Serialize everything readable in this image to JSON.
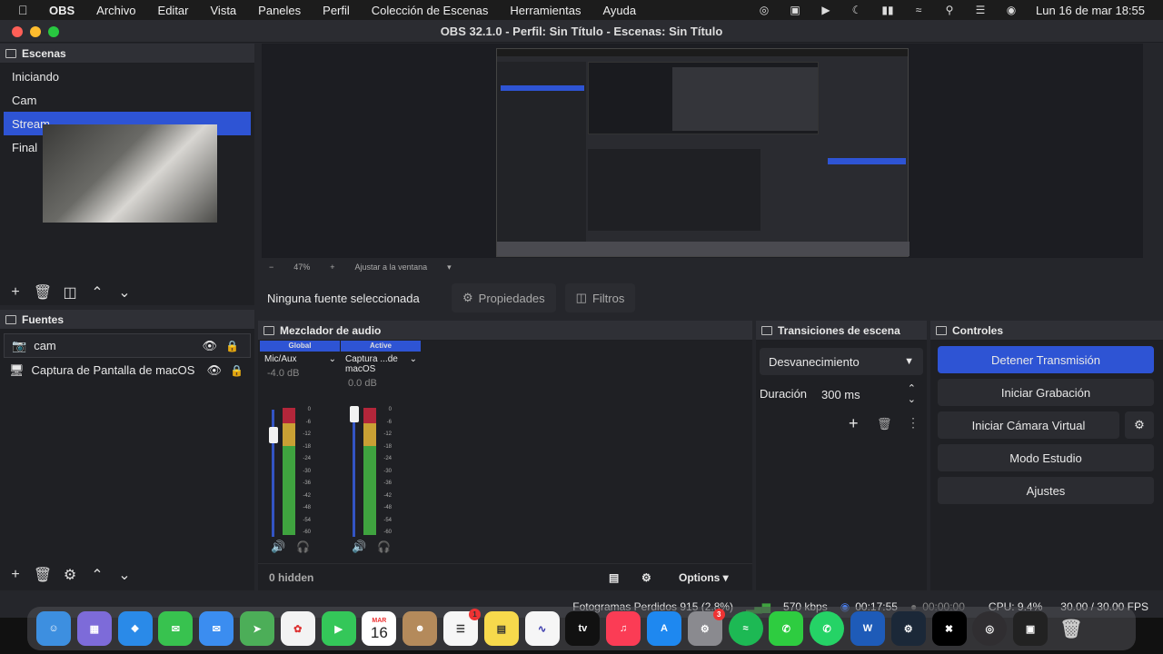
{
  "menubar": {
    "app": "OBS",
    "items": [
      "Archivo",
      "Editar",
      "Vista",
      "Paneles",
      "Perfil",
      "Colección de Escenas",
      "Herramientas",
      "Ayuda"
    ],
    "datetime": "Lun 16 de mar  18:55"
  },
  "window": {
    "title": "OBS 32.1.0 - Perfil: Sin Título - Escenas: Sin Título"
  },
  "scenes": {
    "title": "Escenas",
    "items": [
      "Iniciando",
      "Cam",
      "Stream",
      "Final"
    ],
    "selected": 2
  },
  "preview": {
    "zoom": "47%",
    "fit": "Ajustar a la ventana"
  },
  "props": {
    "no_source": "Ninguna fuente seleccionada",
    "properties": "Propiedades",
    "filters": "Filtros"
  },
  "sources": {
    "title": "Fuentes",
    "items": [
      "cam",
      "Captura de Pantalla de macOS"
    ]
  },
  "mixer": {
    "title": "Mezclador de audio",
    "strips": [
      {
        "header": "Global",
        "name": "Mic/Aux",
        "db": "-4.0 dB"
      },
      {
        "header": "Active",
        "name": "Captura ...de macOS",
        "db": "0.0 dB"
      }
    ],
    "scale": [
      "0",
      "-6",
      "-12",
      "-18",
      "-24",
      "-30",
      "-36",
      "-42",
      "-48",
      "-54",
      "-60"
    ],
    "hidden": "0 hidden",
    "options": "Options"
  },
  "transitions": {
    "title": "Transiciones de escena",
    "selected": "Desvanecimiento",
    "duration_label": "Duración",
    "duration": "300 ms"
  },
  "controls": {
    "title": "Controles",
    "buttons": [
      "Detener Transmisión",
      "Iniciar Grabación",
      "Iniciar Cámara Virtual",
      "Modo Estudio",
      "Ajustes"
    ]
  },
  "status": {
    "dropped": "Fotogramas Perdidos 915 (2.8%)",
    "bitrate": "570 kbps",
    "stream_time": "00:17:55",
    "rec_time": "00:00:00",
    "cpu": "CPU: 9.4%",
    "fps": "30.00 / 30.00 FPS"
  },
  "dock": {
    "calendar_month": "MAR",
    "calendar_day": "16",
    "tv": "tv",
    "reminders_badge": "1",
    "settings_badge": "3"
  },
  "colors": {
    "accent": "#2e54d4",
    "panel": "#1f2024",
    "window": "#25262b"
  }
}
